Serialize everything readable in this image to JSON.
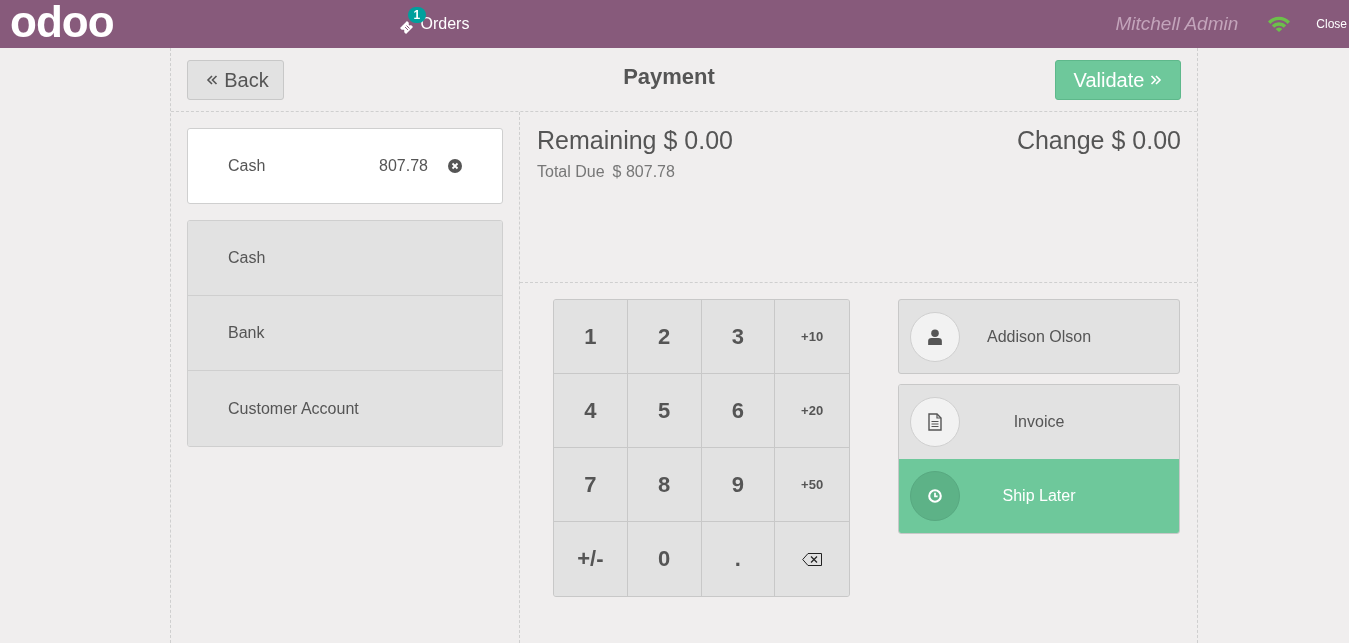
{
  "header": {
    "logo": "odoo",
    "orders": {
      "label": "Orders",
      "badge": "1"
    },
    "user": "Mitchell Admin",
    "connected": true,
    "close": "Close"
  },
  "top_bar": {
    "back": "Back",
    "title": "Payment",
    "validate": {
      "label": "Validate",
      "highlighted": true
    }
  },
  "payment_lines": [
    {
      "method": "Cash",
      "amount": "807.78"
    }
  ],
  "payment_methods": [
    {
      "label": "Cash"
    },
    {
      "label": "Bank"
    },
    {
      "label": "Customer Account"
    }
  ],
  "summary": {
    "remaining": {
      "label": "Remaining",
      "value": "$ 0.00"
    },
    "change": {
      "label": "Change",
      "value": "$ 0.00"
    },
    "total_due": {
      "label": "Total Due",
      "value": "$ 807.78"
    }
  },
  "numpad": [
    {
      "kind": "digit",
      "label": "1"
    },
    {
      "kind": "digit",
      "label": "2"
    },
    {
      "kind": "digit",
      "label": "3"
    },
    {
      "kind": "add",
      "label": "+10"
    },
    {
      "kind": "digit",
      "label": "4"
    },
    {
      "kind": "digit",
      "label": "5"
    },
    {
      "kind": "digit",
      "label": "6"
    },
    {
      "kind": "add",
      "label": "+20"
    },
    {
      "kind": "digit",
      "label": "7"
    },
    {
      "kind": "digit",
      "label": "8"
    },
    {
      "kind": "digit",
      "label": "9"
    },
    {
      "kind": "add",
      "label": "+50"
    },
    {
      "kind": "digit",
      "label": "+/-"
    },
    {
      "kind": "digit",
      "label": "0"
    },
    {
      "kind": "digit",
      "label": "."
    },
    {
      "kind": "backspace"
    }
  ],
  "customer": {
    "name": "Addison Olson"
  },
  "options": [
    {
      "kind": "invoice",
      "label": "Invoice",
      "selected": false
    },
    {
      "kind": "ship_later",
      "label": "Ship Later",
      "selected": true
    }
  ]
}
